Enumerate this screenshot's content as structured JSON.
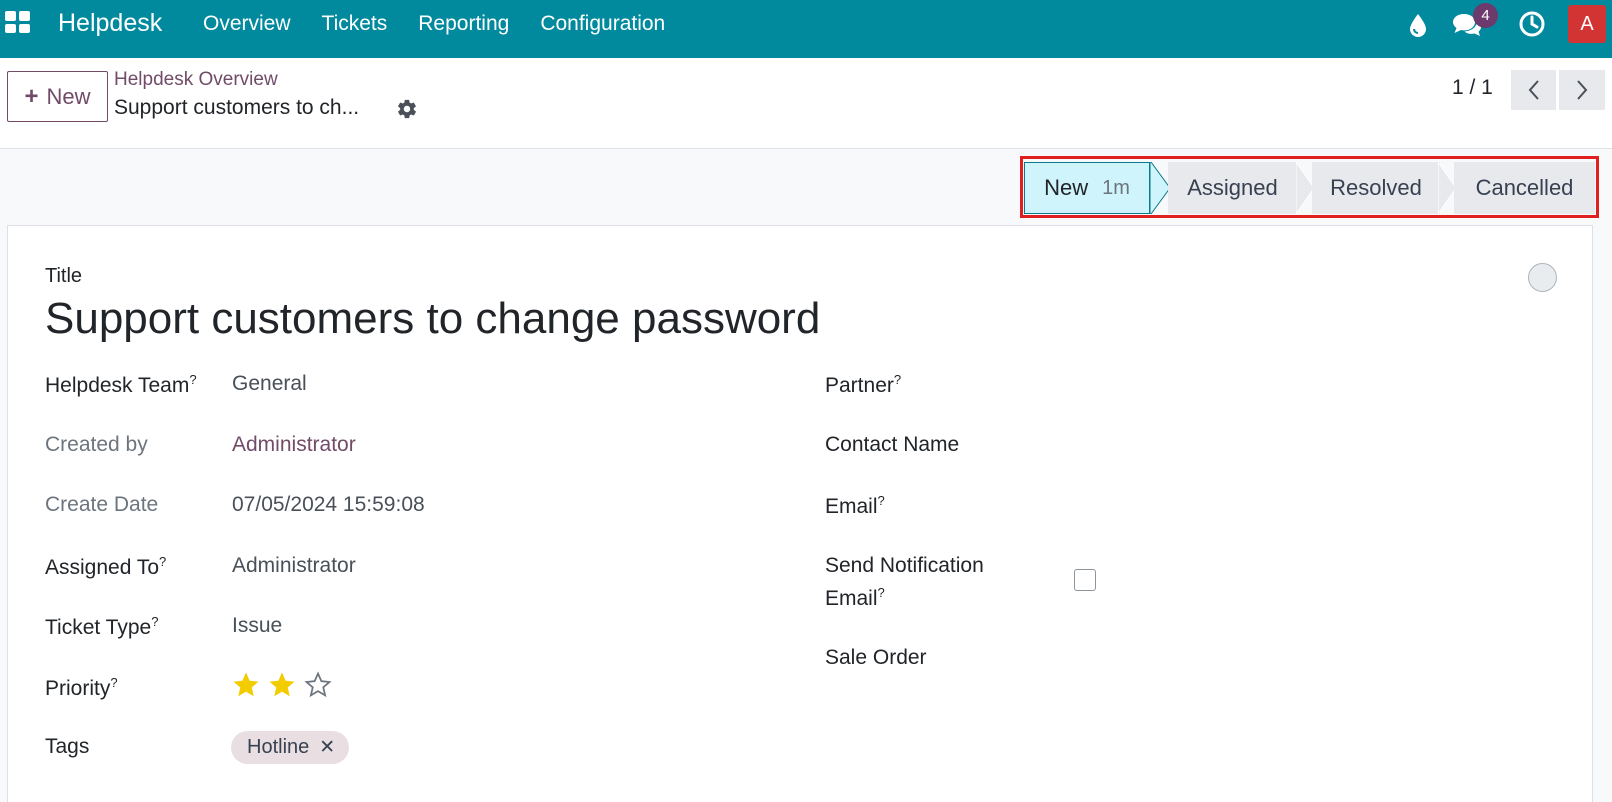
{
  "navbar": {
    "brand": "Helpdesk",
    "menu": [
      "Overview",
      "Tickets",
      "Reporting",
      "Configuration"
    ],
    "chat_count": "4",
    "avatar_letter": "A"
  },
  "control": {
    "new_label": "New",
    "breadcrumb_parent": "Helpdesk Overview",
    "breadcrumb_current": "Support customers to ch...",
    "pager": "1 / 1"
  },
  "status": {
    "stages": [
      {
        "label": "New",
        "duration": "1m",
        "active": true
      },
      {
        "label": "Assigned",
        "active": false
      },
      {
        "label": "Resolved",
        "active": false
      },
      {
        "label": "Cancelled",
        "active": false
      }
    ]
  },
  "form": {
    "title_label": "Title",
    "title_value": "Support customers to change password",
    "left": {
      "team_label": "Helpdesk Team",
      "team_value": "General",
      "created_by_label": "Created by",
      "created_by_value": "Administrator",
      "create_date_label": "Create Date",
      "create_date_value": "07/05/2024 15:59:08",
      "assigned_label": "Assigned To",
      "assigned_value": "Administrator",
      "ticket_type_label": "Ticket Type",
      "ticket_type_value": "Issue",
      "priority_label": "Priority",
      "priority_stars": 2,
      "priority_max": 3,
      "tags_label": "Tags",
      "tag_value": "Hotline"
    },
    "right": {
      "partner_label": "Partner",
      "contact_label": "Contact Name",
      "email_label": "Email",
      "notif_label_1": "Send Notification",
      "notif_label_2": "Email",
      "sale_order_label": "Sale Order"
    },
    "help_mark": "?"
  },
  "colors": {
    "navbar": "#018a9d",
    "brand_accent": "#714b67",
    "active_stage": "#cff4fc",
    "highlight_frame": "#e0201f",
    "star_filled": "#f3cc00"
  }
}
